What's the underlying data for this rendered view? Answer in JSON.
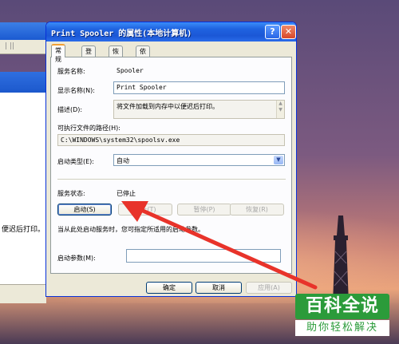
{
  "background_window": {
    "toolbar_text": "| ||",
    "partial_description": "便迟后打印。"
  },
  "dialog": {
    "title": "Print Spooler 的属性(本地计算机)",
    "help_icon": "question-icon",
    "close_icon": "close-icon",
    "tabs": [
      {
        "label": "常规",
        "active": true
      },
      {
        "label": "登录",
        "active": false
      },
      {
        "label": "恢复",
        "active": false
      },
      {
        "label": "依存关系",
        "active": false
      }
    ],
    "general": {
      "service_name_label": "服务名称:",
      "service_name_value": "Spooler",
      "display_name_label": "显示名称(N):",
      "display_name_value": "Print Spooler",
      "description_label": "描述(D):",
      "description_value": "将文件加载到内存中以便迟后打印。",
      "exe_path_label": "可执行文件的路径(H):",
      "exe_path_value": "C:\\WINDOWS\\system32\\spoolsv.exe",
      "startup_type_label": "启动类型(E):",
      "startup_type_value": "自动",
      "status_label": "服务状态:",
      "status_value": "已停止",
      "buttons": {
        "start": "启动(S)",
        "stop": "停止(T)",
        "pause": "暂停(P)",
        "resume": "恢复(R)"
      },
      "hint_text": "当从此处启动服务时，您可指定所适用的启动参数。",
      "start_params_label": "启动参数(M):",
      "start_params_value": ""
    },
    "footer": {
      "ok": "确定",
      "cancel": "取消",
      "apply": "应用(A)"
    }
  },
  "watermark": {
    "title": "百科全说",
    "subtitle": "助你轻松解决"
  },
  "colors": {
    "annotation_arrow": "#e8332a",
    "watermark_green": "#2b9b3a",
    "title_bar_blue": "#1f63e0"
  }
}
